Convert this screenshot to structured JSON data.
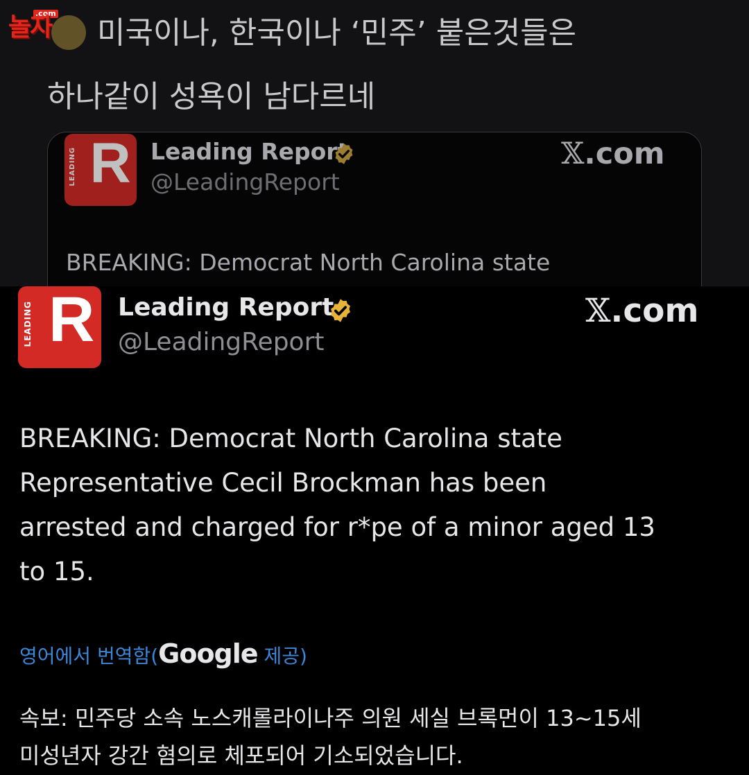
{
  "site_logo": {
    "domain_tag": ".com",
    "wordmark": "놀자"
  },
  "post": {
    "line1": "미국이나, 한국이나 ‘민주’ 붙은것들은",
    "line2": "하나같이 성욕이 남다르네"
  },
  "embedded_tweet": {
    "account_name": "Leading Report",
    "handle": "@LeadingReport",
    "avatar_text_vertical": "LEADING",
    "avatar_letter": "R",
    "source_site": "X.com",
    "source_site_x": "𝕏",
    "source_site_suffix": ".com",
    "tweet_lines": [
      "BREAKING: Democrat North Carolina state",
      "Representative Cecil Brockman has been",
      "arrested and charged for r*pe of a minor aged 13",
      "to 15."
    ],
    "translation_note_prefix": "영어에서 번역함(",
    "translation_provider": "Google",
    "translation_note_suffix": " 제공)",
    "translated_lines": [
      "속보: 민주당 소속 노스캐롤라이나주 의원 세실 브록먼이 13~15세",
      "미성년자 강간 혐의로 체포되어 기소되었습니다."
    ]
  },
  "colors": {
    "brand_red": "#d32a25",
    "verified_badge": "#e8b339",
    "link_blue": "#3c88d8"
  }
}
